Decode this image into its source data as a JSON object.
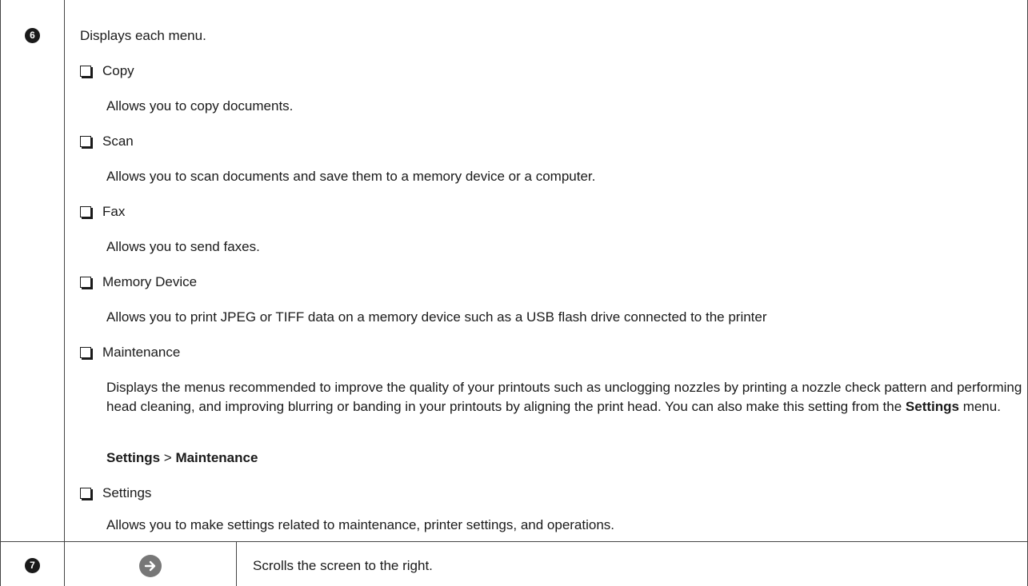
{
  "row6": {
    "badge": "6",
    "intro": "Displays each menu.",
    "items": [
      {
        "title": "Copy",
        "desc": "Allows you to copy documents."
      },
      {
        "title": "Scan",
        "desc": "Allows you to scan documents and save them to a memory device or a computer."
      },
      {
        "title": "Fax",
        "desc": "Allows you to send faxes."
      },
      {
        "title": "Memory Device",
        "desc": "Allows you to print JPEG or TIFF data on a memory device such as a USB flash drive connected to the printer"
      },
      {
        "title": "Maintenance",
        "desc_part1": "Displays the menus recommended to improve the quality of your printouts such as unclogging nozzles by printing a nozzle check pattern and performing head cleaning, and improving blurring or banding in your printouts by aligning the print head. You can also make this setting from the ",
        "desc_bold": "Settings",
        "desc_part2": " menu.",
        "path_a": "Settings",
        "path_sep": " > ",
        "path_b": "Maintenance"
      },
      {
        "title": "Settings",
        "desc": "Allows you to make settings related to maintenance, printer settings, and operations."
      }
    ]
  },
  "row7": {
    "badge": "7",
    "icon": "arrow-right-circle-icon",
    "desc": "Scrolls the screen to the right."
  }
}
